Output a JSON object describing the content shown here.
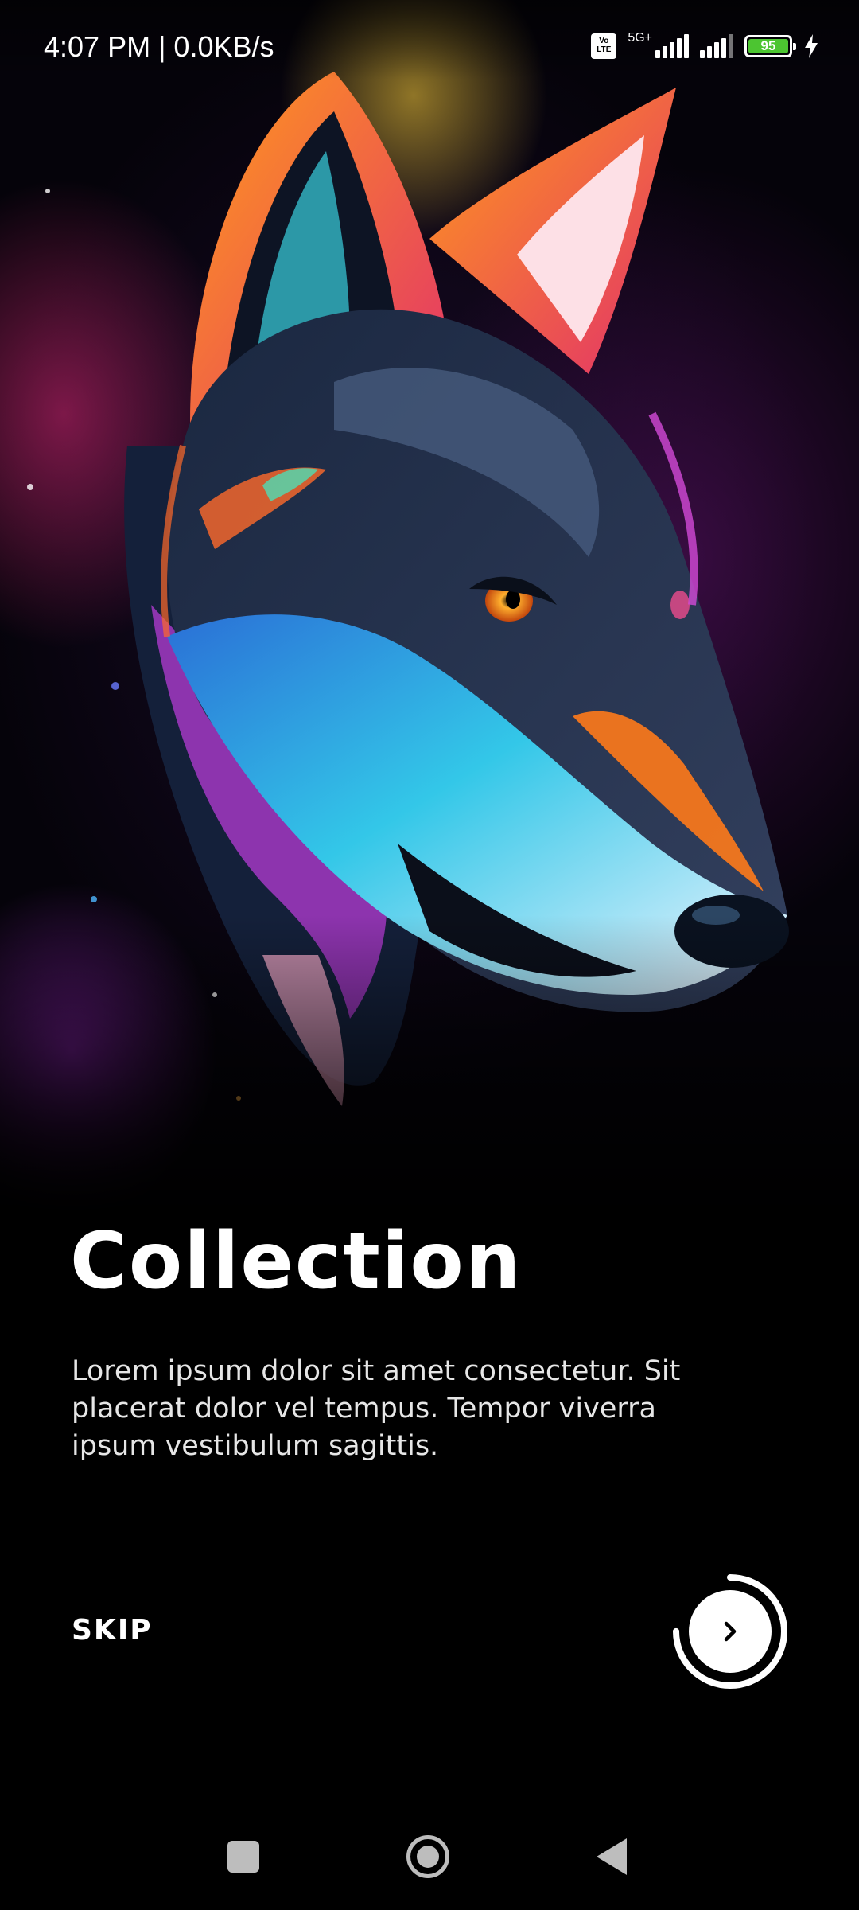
{
  "status_bar": {
    "time": "4:07 PM | 0.0KB/s",
    "volte": "Vo LTE",
    "network_type": "5G+",
    "battery_level": "95",
    "icons": [
      "volte-icon",
      "signal-icon",
      "signal-icon",
      "battery-icon",
      "charging-icon"
    ]
  },
  "hero": {
    "image": "wolf-artwork",
    "colors": [
      "#1b0b2a",
      "#2b9fe0",
      "#ff7a1a",
      "#c23cd8",
      "#ffd23c"
    ]
  },
  "onboarding": {
    "title": "Collection",
    "description": "Lorem ipsum dolor sit amet consectetur. Sit placerat dolor vel tempus. Tempor viverra ipsum vestibulum sagittis.",
    "skip_label": "SKIP",
    "next_icon": "chevron-right-icon",
    "progress": 0.75
  },
  "nav_bar": {
    "buttons": [
      "recents-button",
      "home-button",
      "back-button"
    ]
  }
}
